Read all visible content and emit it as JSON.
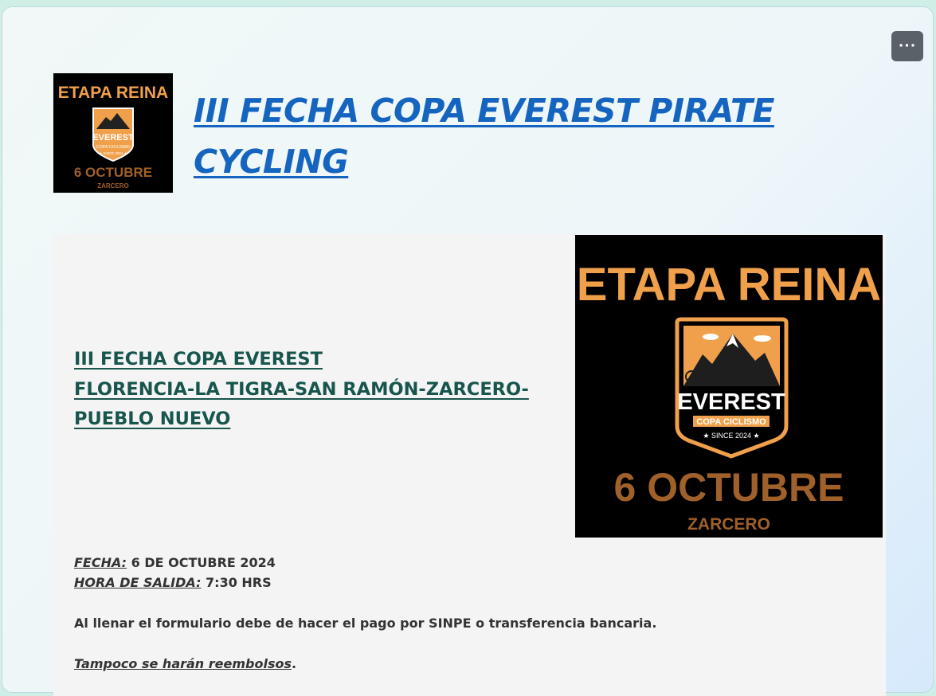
{
  "form": {
    "title": "III FECHA COPA EVEREST PIRATE CYCLING",
    "more_label": "···"
  },
  "poster": {
    "headline": "ETAPA REINA",
    "badge_name": "EVEREST",
    "badge_sub": "COPA CICLISMO",
    "badge_since": "★ SINCE 2024 ★",
    "date": "6 OCTUBRE",
    "location": "ZARCERO"
  },
  "panel": {
    "heading_line1": "III FECHA COPA EVEREST",
    "heading_line2": "FLORENCIA-LA TIGRA-SAN RAMÓN-ZARCERO-",
    "heading_line3": "PUEBLO NUEVO",
    "fecha_label": "FECHA:",
    "fecha_value": " 6 DE OCTUBRE 2024",
    "hora_label": "HORA DE SALIDA:",
    "hora_value": " 7:30 HRS",
    "payment_note": "Al llenar el formulario debe de hacer el pago por SINPE o transferencia bancaria.",
    "refund_note": "Tampoco se harán reembolsos",
    "refund_period": "."
  },
  "colors": {
    "title_blue": "#1565c0",
    "heading_teal": "#17554d",
    "poster_orange": "#f0a04b",
    "poster_brown": "#a0602a"
  }
}
